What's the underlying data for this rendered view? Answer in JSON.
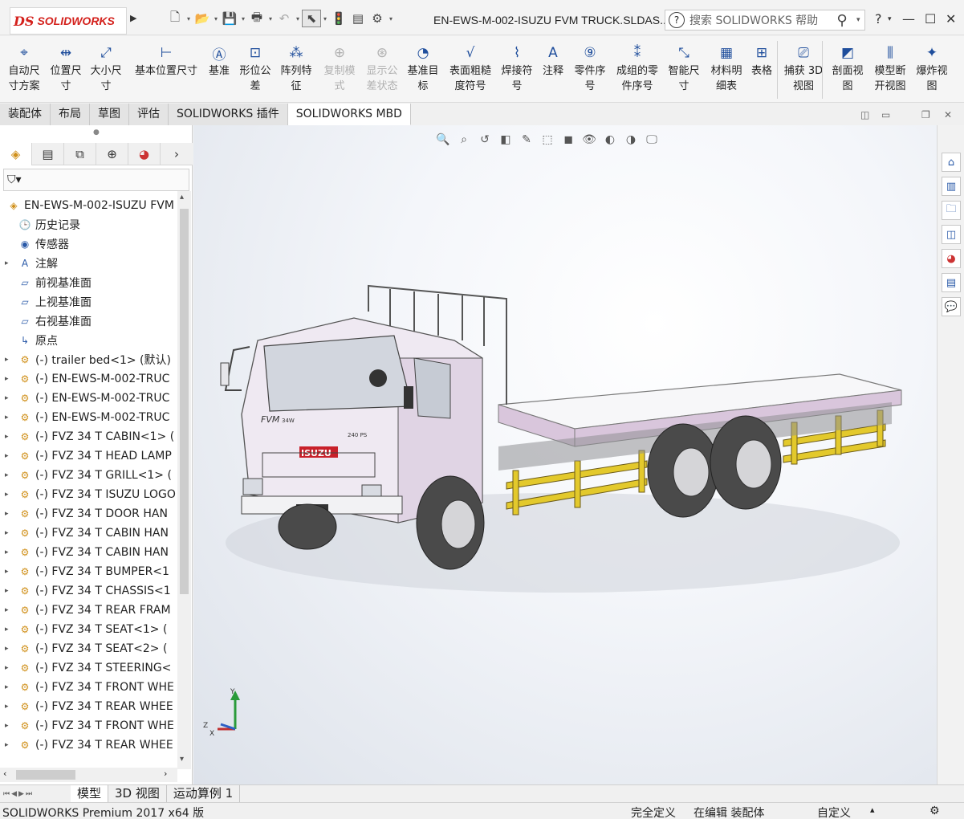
{
  "app": {
    "logo_ds": "DS",
    "logo_text": "SOLIDWORKS",
    "document_title": "EN-EWS-M-002-ISUZU FVM TRUCK.SLDAS...",
    "search_placeholder": "搜索 SOLIDWORKS 帮助",
    "help_label": "?"
  },
  "ribbon": [
    {
      "name": "auto-dimension-scheme",
      "label": "自动尺\n寸方案",
      "icon": "auto-dimension-icon",
      "enabled": true
    },
    {
      "name": "location-dimension",
      "label": "位置尺\n寸",
      "icon": "location-dimension-icon",
      "enabled": true
    },
    {
      "name": "size-dimension",
      "label": "大小尺\n寸",
      "icon": "size-dimension-icon",
      "enabled": true
    },
    {
      "name": "basic-location-dimension",
      "label": "基本位置尺寸",
      "icon": "basic-location-icon",
      "enabled": true
    },
    {
      "name": "datum",
      "label": "基准",
      "icon": "datum-icon",
      "enabled": true
    },
    {
      "name": "geometric-tolerance",
      "label": "形位公\n差",
      "icon": "geometric-tolerance-icon",
      "enabled": true
    },
    {
      "name": "pattern-feature",
      "label": "阵列特\n征",
      "icon": "pattern-feature-icon",
      "enabled": true
    },
    {
      "name": "copy-scheme",
      "label": "复制模\n式",
      "icon": "copy-scheme-icon",
      "enabled": false
    },
    {
      "name": "show-tolerance-status",
      "label": "显示公\n差状态",
      "icon": "tolerance-status-icon",
      "enabled": false
    },
    {
      "name": "datum-target",
      "label": "基准目\n标",
      "icon": "datum-target-icon",
      "enabled": true
    },
    {
      "name": "surface-finish",
      "label": "表面粗糙\n度符号",
      "icon": "surface-finish-icon",
      "enabled": true
    },
    {
      "name": "weld-symbol",
      "label": "焊接符\n号",
      "icon": "weld-symbol-icon",
      "enabled": true
    },
    {
      "name": "note",
      "label": "注释",
      "icon": "note-icon",
      "enabled": true
    },
    {
      "name": "balloon",
      "label": "零件序\n号",
      "icon": "balloon-icon",
      "enabled": true
    },
    {
      "name": "stacked-balloon",
      "label": "成组的零\n件序号",
      "icon": "stacked-balloon-icon",
      "enabled": true
    },
    {
      "name": "smart-dimension",
      "label": "智能尺\n寸",
      "icon": "smart-dimension-icon",
      "enabled": true
    },
    {
      "name": "bom",
      "label": "材料明\n细表",
      "icon": "bom-icon",
      "enabled": true
    },
    {
      "name": "table",
      "label": "表格",
      "icon": "table-icon",
      "enabled": true
    },
    {
      "name": "capture-3d-view",
      "label": "捕获 3D\n视图",
      "icon": "capture-3d-icon",
      "enabled": true
    },
    {
      "name": "section-view",
      "label": "剖面视\n图",
      "icon": "section-view-icon",
      "enabled": true
    },
    {
      "name": "model-break-view",
      "label": "模型断\n开视图",
      "icon": "break-view-icon",
      "enabled": true
    },
    {
      "name": "explode-view",
      "label": "爆炸视\n图",
      "icon": "explode-view-icon",
      "enabled": true
    }
  ],
  "tabs": [
    "装配体",
    "布局",
    "草图",
    "评估",
    "SOLIDWORKS 插件",
    "SOLIDWORKS MBD"
  ],
  "active_tab": "SOLIDWORKS MBD",
  "tree": {
    "root": "EN-EWS-M-002-ISUZU FVM",
    "fixed": [
      {
        "label": "历史记录",
        "icon": "history-icon"
      },
      {
        "label": "传感器",
        "icon": "sensor-icon"
      },
      {
        "label": "注解",
        "icon": "annotation-icon",
        "expandable": true
      },
      {
        "label": "前视基准面",
        "icon": "plane-icon"
      },
      {
        "label": "上视基准面",
        "icon": "plane-icon"
      },
      {
        "label": "右视基准面",
        "icon": "plane-icon"
      },
      {
        "label": "原点",
        "icon": "origin-icon"
      }
    ],
    "components": [
      "(-) trailer bed<1> (默认)",
      "(-) EN-EWS-M-002-TRUC",
      "(-) EN-EWS-M-002-TRUC",
      "(-) EN-EWS-M-002-TRUC",
      "(-) FVZ 34 T CABIN<1> (",
      "(-) FVZ 34 T HEAD LAMP",
      "(-) FVZ 34 T GRILL<1> (",
      "(-) FVZ 34 T ISUZU LOGO",
      "(-) FVZ 34 T DOOR HAN",
      "(-) FVZ 34 T CABIN HAN",
      "(-) FVZ 34 T CABIN HAN",
      "(-) FVZ 34 T BUMPER<1",
      "(-) FVZ 34 T CHASSIS<1",
      "(-) FVZ 34 T REAR FRAM",
      "(-) FVZ 34 T SEAT<1> (",
      "(-) FVZ 34 T SEAT<2> (",
      "(-) FVZ 34 T STEERING<",
      "(-) FVZ 34 T FRONT WHE",
      "(-) FVZ 34 T REAR WHEE",
      "(-) FVZ 34 T FRONT WHE",
      "(-) FVZ 34 T REAR WHEE"
    ]
  },
  "model": {
    "cab_badge": "FVM",
    "cab_sub": "34W",
    "cab_sub2": "240 PS",
    "brand": "ISUZU",
    "triad": {
      "x": "X",
      "y": "Y",
      "z": "Z"
    }
  },
  "bottom_tabs": [
    "模型",
    "3D 视图",
    "运动算例 1"
  ],
  "status": {
    "product": "SOLIDWORKS Premium 2017 x64 版",
    "definition": "完全定义",
    "mode": "在编辑 装配体",
    "units": "自定义"
  },
  "colors": {
    "accent": "#1f4e9c",
    "cab_body": "#e0d4e4",
    "bed_frame": "#d9c6dc",
    "yellow_rails": "#e3c92c",
    "tire": "#4a4a4a"
  }
}
